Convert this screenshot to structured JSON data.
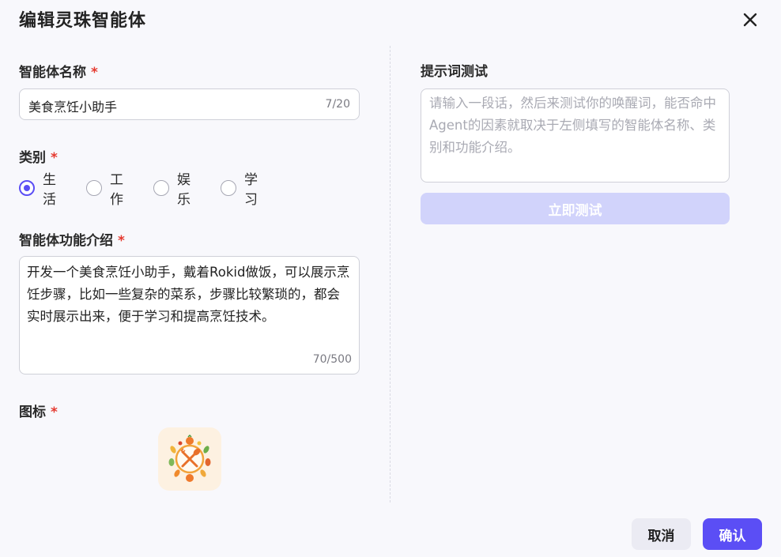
{
  "dialog": {
    "title": "编辑灵珠智能体",
    "close_icon": "close-icon"
  },
  "form": {
    "name": {
      "label": "智能体名称",
      "required_mark": "*",
      "value": "美食烹饪小助手",
      "counter": "7/20"
    },
    "category": {
      "label": "类别",
      "required_mark": "*",
      "options": [
        "生活",
        "工作",
        "娱乐",
        "学习"
      ],
      "selected": "生活"
    },
    "description": {
      "label": "智能体功能介绍",
      "required_mark": "*",
      "value": "开发一个美食烹饪小助手，戴着Rokid做饭，可以展示烹饪步骤，比如一些复杂的菜系，步骤比较繁琐的，都会实时展示出来，便于学习和提高烹饪技术。",
      "counter": "70/500"
    },
    "icon": {
      "label": "图标",
      "required_mark": "*",
      "image": "cooking-plate-icon"
    }
  },
  "prompt_test": {
    "label": "提示词测试",
    "placeholder": "请输入一段话，然后来测试你的唤醒词，能否命中Agent的因素就取决于左侧填写的智能体名称、类别和功能介绍。",
    "button_label": "立即测试"
  },
  "footer": {
    "cancel_label": "取消",
    "confirm_label": "确认"
  },
  "colors": {
    "accent": "#5b4ef5",
    "accent_disabled": "#d1d3fb",
    "required": "#e5392f",
    "icon_tile_bg": "#fdf1e1"
  }
}
